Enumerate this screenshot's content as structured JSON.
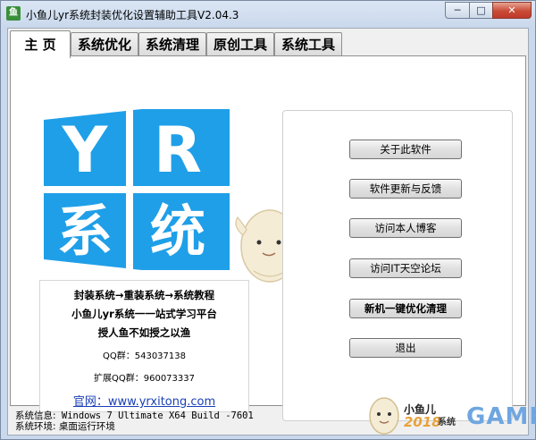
{
  "window": {
    "title": "小鱼儿yr系统封装优化设置辅助工具V2.04.3",
    "icon_text": "鱼",
    "controls": {
      "minimize": "─",
      "maximize": "□",
      "close": "✕"
    }
  },
  "tabs": [
    {
      "label": "主 页",
      "active": true
    },
    {
      "label": "系统优化",
      "active": false
    },
    {
      "label": "系统清理",
      "active": false
    },
    {
      "label": "原创工具",
      "active": false
    },
    {
      "label": "系统工具",
      "active": false
    }
  ],
  "logo": {
    "top": "Y R",
    "bottom": "系统",
    "colors": {
      "blue": "#1f9fe8",
      "white": "#ffffff"
    }
  },
  "info": {
    "line1": "封装系统→重装系统→系统教程",
    "line2": "小鱼儿yr系统一一站式学习平台",
    "line3": "授人鱼不如授之以渔",
    "qq": "QQ群：543037138",
    "qq_ext": "扩展QQ群：960073337",
    "website": "官网：www.yrxitong.com"
  },
  "buttons": [
    {
      "label": "关于此软件",
      "bold": false
    },
    {
      "label": "软件更新与反馈",
      "bold": false
    },
    {
      "label": "访问本人博客",
      "bold": false
    },
    {
      "label": "访问IT天空论坛",
      "bold": false
    },
    {
      "label": "新机一键优化清理",
      "bold": true
    },
    {
      "label": "退出",
      "bold": false
    }
  ],
  "status": {
    "sys_info_label": "系统信息:",
    "sys_info_value": " Windows 7 Ultimate X64 Build -7601",
    "env_label": "系统环境:",
    "env_value": " 桌面运行环境"
  },
  "watermark": {
    "text1": "小鱼儿",
    "text2": "2018",
    "text3": "GAME",
    "overlap": "系统"
  }
}
